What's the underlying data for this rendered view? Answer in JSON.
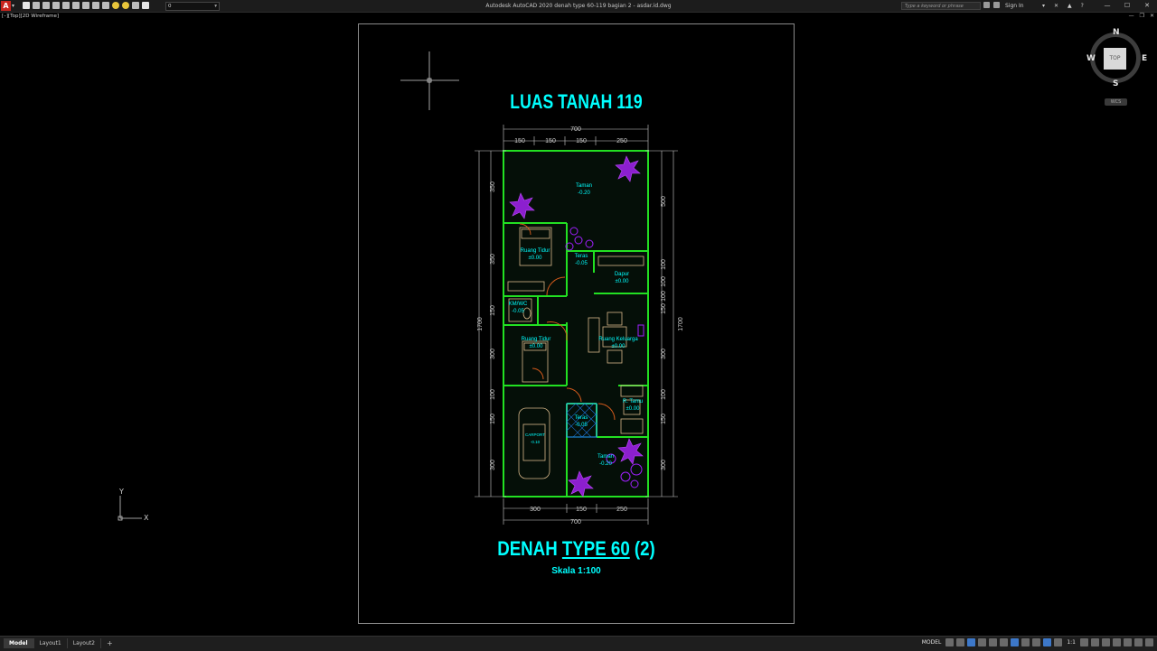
{
  "window": {
    "caption": "Autodesk AutoCAD 2020    denah type 60-119 bagian 2 - asdar.id.dwg",
    "app_logo": "A",
    "layer_value": "0",
    "search_placeholder": "Type a keyword or phrase",
    "sign_in": "Sign In",
    "help": "?",
    "viewport_label": "[–][Top][2D Wireframe]"
  },
  "icons": [
    "new-icon",
    "open-icon",
    "save-icon",
    "saveas-icon",
    "plot-icon",
    "undo-icon",
    "redo-icon",
    "lightbulb-icon",
    "sun-icon",
    "layer-icon"
  ],
  "drawing": {
    "title_top": "LUAS TANAH 119",
    "title_bottom_a": "DENAH ",
    "title_bottom_b": "TYPE 60",
    "title_bottom_c": " (2)",
    "scale": "Skala 1:100",
    "rooms": [
      {
        "name": "Taman",
        "level": "-0.20"
      },
      {
        "name": "Ruang Tidur",
        "level": "±0.00"
      },
      {
        "name": "Teras",
        "level": "-0.05"
      },
      {
        "name": "Dapur",
        "level": "±0.00"
      },
      {
        "name": "KM/WC",
        "level": "-0.05"
      },
      {
        "name": "Ruang Tidur",
        "level": "±0.00"
      },
      {
        "name": "Ruang Keluarga",
        "level": "±0.00"
      },
      {
        "name": "R. Tamu",
        "level": "±0.00"
      },
      {
        "name": "Teras",
        "level": "-0.05"
      },
      {
        "name": "CARPORT",
        "level": "-0.10"
      },
      {
        "name": "Taman",
        "level": "-0.20"
      }
    ],
    "dims_top": [
      "150",
      "150",
      "150",
      "250"
    ],
    "dims_total": "700",
    "dims_bottom": [
      "300",
      "150",
      "250"
    ],
    "dims_left": [
      "350",
      "350",
      "150",
      "300",
      "100",
      "150",
      "300"
    ],
    "dims_right": [
      "500",
      "100",
      "100",
      "100",
      "150",
      "300",
      "100",
      "150",
      "300"
    ],
    "dims_height": "1700",
    "ucs_x": "X",
    "ucs_y": "Y"
  },
  "viewcube": {
    "n": "N",
    "s": "S",
    "e": "E",
    "w": "W",
    "top": "TOP",
    "wcs": "WCS"
  },
  "status": {
    "tabs": [
      "Model",
      "Layout1",
      "Layout2"
    ],
    "add_tab": "+",
    "model_label": "MODEL",
    "scale": "1:1"
  },
  "colors": {
    "cyan": "#00ffff",
    "wall_green": "#22e022",
    "furniture": "#d8b88a",
    "tree_purple": "#a020ff",
    "door_orange": "#d25a1c"
  }
}
